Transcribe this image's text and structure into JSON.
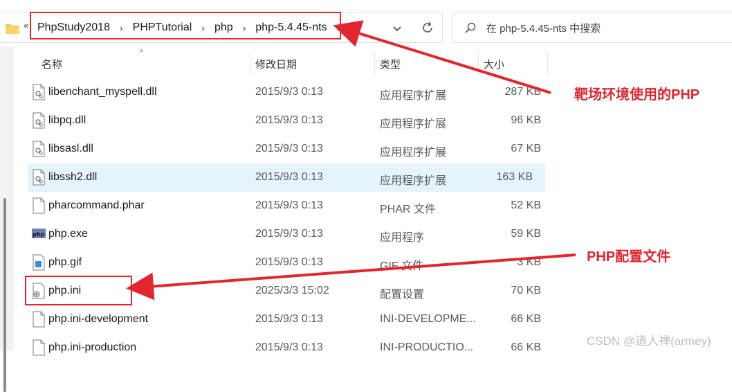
{
  "address_bar": {
    "more_glyph": "«",
    "crumbs": [
      "PhpStudy2018",
      "PHPTutorial",
      "php",
      "php-5.4.45-nts"
    ],
    "separator": "›"
  },
  "search": {
    "placeholder": "在 php-5.4.45-nts 中搜索"
  },
  "columns": {
    "name": "名称",
    "date": "修改日期",
    "type": "类型",
    "size": "大小"
  },
  "files": [
    {
      "name": "libenchant_myspell.dll",
      "date": "2015/9/3 0:13",
      "type": "应用程序扩展",
      "size": "287 KB",
      "icon": "dll-icon"
    },
    {
      "name": "libpq.dll",
      "date": "2015/9/3 0:13",
      "type": "应用程序扩展",
      "size": "96 KB",
      "icon": "dll-icon"
    },
    {
      "name": "libsasl.dll",
      "date": "2015/9/3 0:13",
      "type": "应用程序扩展",
      "size": "67 KB",
      "icon": "dll-icon"
    },
    {
      "name": "libssh2.dll",
      "date": "2015/9/3 0:13",
      "type": "应用程序扩展",
      "size": "163 KB",
      "icon": "dll-icon",
      "selected": true
    },
    {
      "name": "pharcommand.phar",
      "date": "2015/9/3 0:13",
      "type": "PHAR 文件",
      "size": "52 KB",
      "icon": "file-icon"
    },
    {
      "name": "php.exe",
      "date": "2015/9/3 0:13",
      "type": "应用程序",
      "size": "59 KB",
      "icon": "php-exe-icon"
    },
    {
      "name": "php.gif",
      "date": "2015/9/3 0:13",
      "type": "GIF 文件",
      "size": "3 KB",
      "icon": "image-file-icon"
    },
    {
      "name": "php.ini",
      "date": "2025/3/3 15:02",
      "type": "配置设置",
      "size": "70 KB",
      "icon": "settings-file-icon"
    },
    {
      "name": "php.ini-development",
      "date": "2015/9/3 0:13",
      "type": "INI-DEVELOPME...",
      "size": "66 KB",
      "icon": "file-icon"
    },
    {
      "name": "php.ini-production",
      "date": "2015/9/3 0:13",
      "type": "INI-PRODUCTIO...",
      "size": "66 KB",
      "icon": "file-icon"
    }
  ],
  "annotations": {
    "range_php": "靶场环境使用的PHP",
    "php_config": "PHP配置文件"
  },
  "watermark": "CSDN @道人禅(armey)",
  "colors": {
    "annotation": "#e3262e",
    "selection": "#e5f3fb",
    "folder": "#f2c14e"
  }
}
